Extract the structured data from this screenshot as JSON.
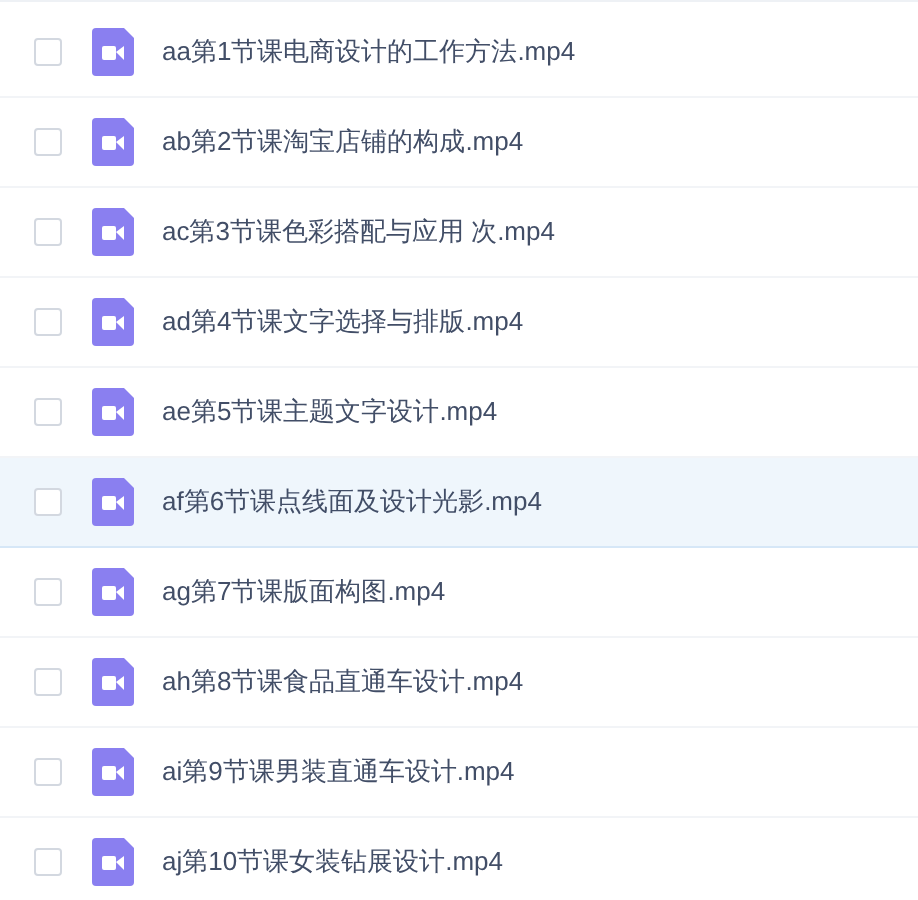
{
  "files": [
    {
      "name": "aa第1节课电商设计的工作方法.mp4",
      "checked": false,
      "highlighted": false
    },
    {
      "name": "ab第2节课淘宝店铺的构成.mp4",
      "checked": false,
      "highlighted": false
    },
    {
      "name": "ac第3节课色彩搭配与应用 次.mp4",
      "checked": false,
      "highlighted": false
    },
    {
      "name": "ad第4节课文字选择与排版.mp4",
      "checked": false,
      "highlighted": false
    },
    {
      "name": "ae第5节课主题文字设计.mp4",
      "checked": false,
      "highlighted": false
    },
    {
      "name": "af第6节课点线面及设计光影.mp4",
      "checked": false,
      "highlighted": true
    },
    {
      "name": "ag第7节课版面构图.mp4",
      "checked": false,
      "highlighted": false
    },
    {
      "name": "ah第8节课食品直通车设计.mp4",
      "checked": false,
      "highlighted": false
    },
    {
      "name": "ai第9节课男装直通车设计.mp4",
      "checked": false,
      "highlighted": false
    },
    {
      "name": "aj第10节课女装钻展设计.mp4",
      "checked": false,
      "highlighted": false
    }
  ]
}
